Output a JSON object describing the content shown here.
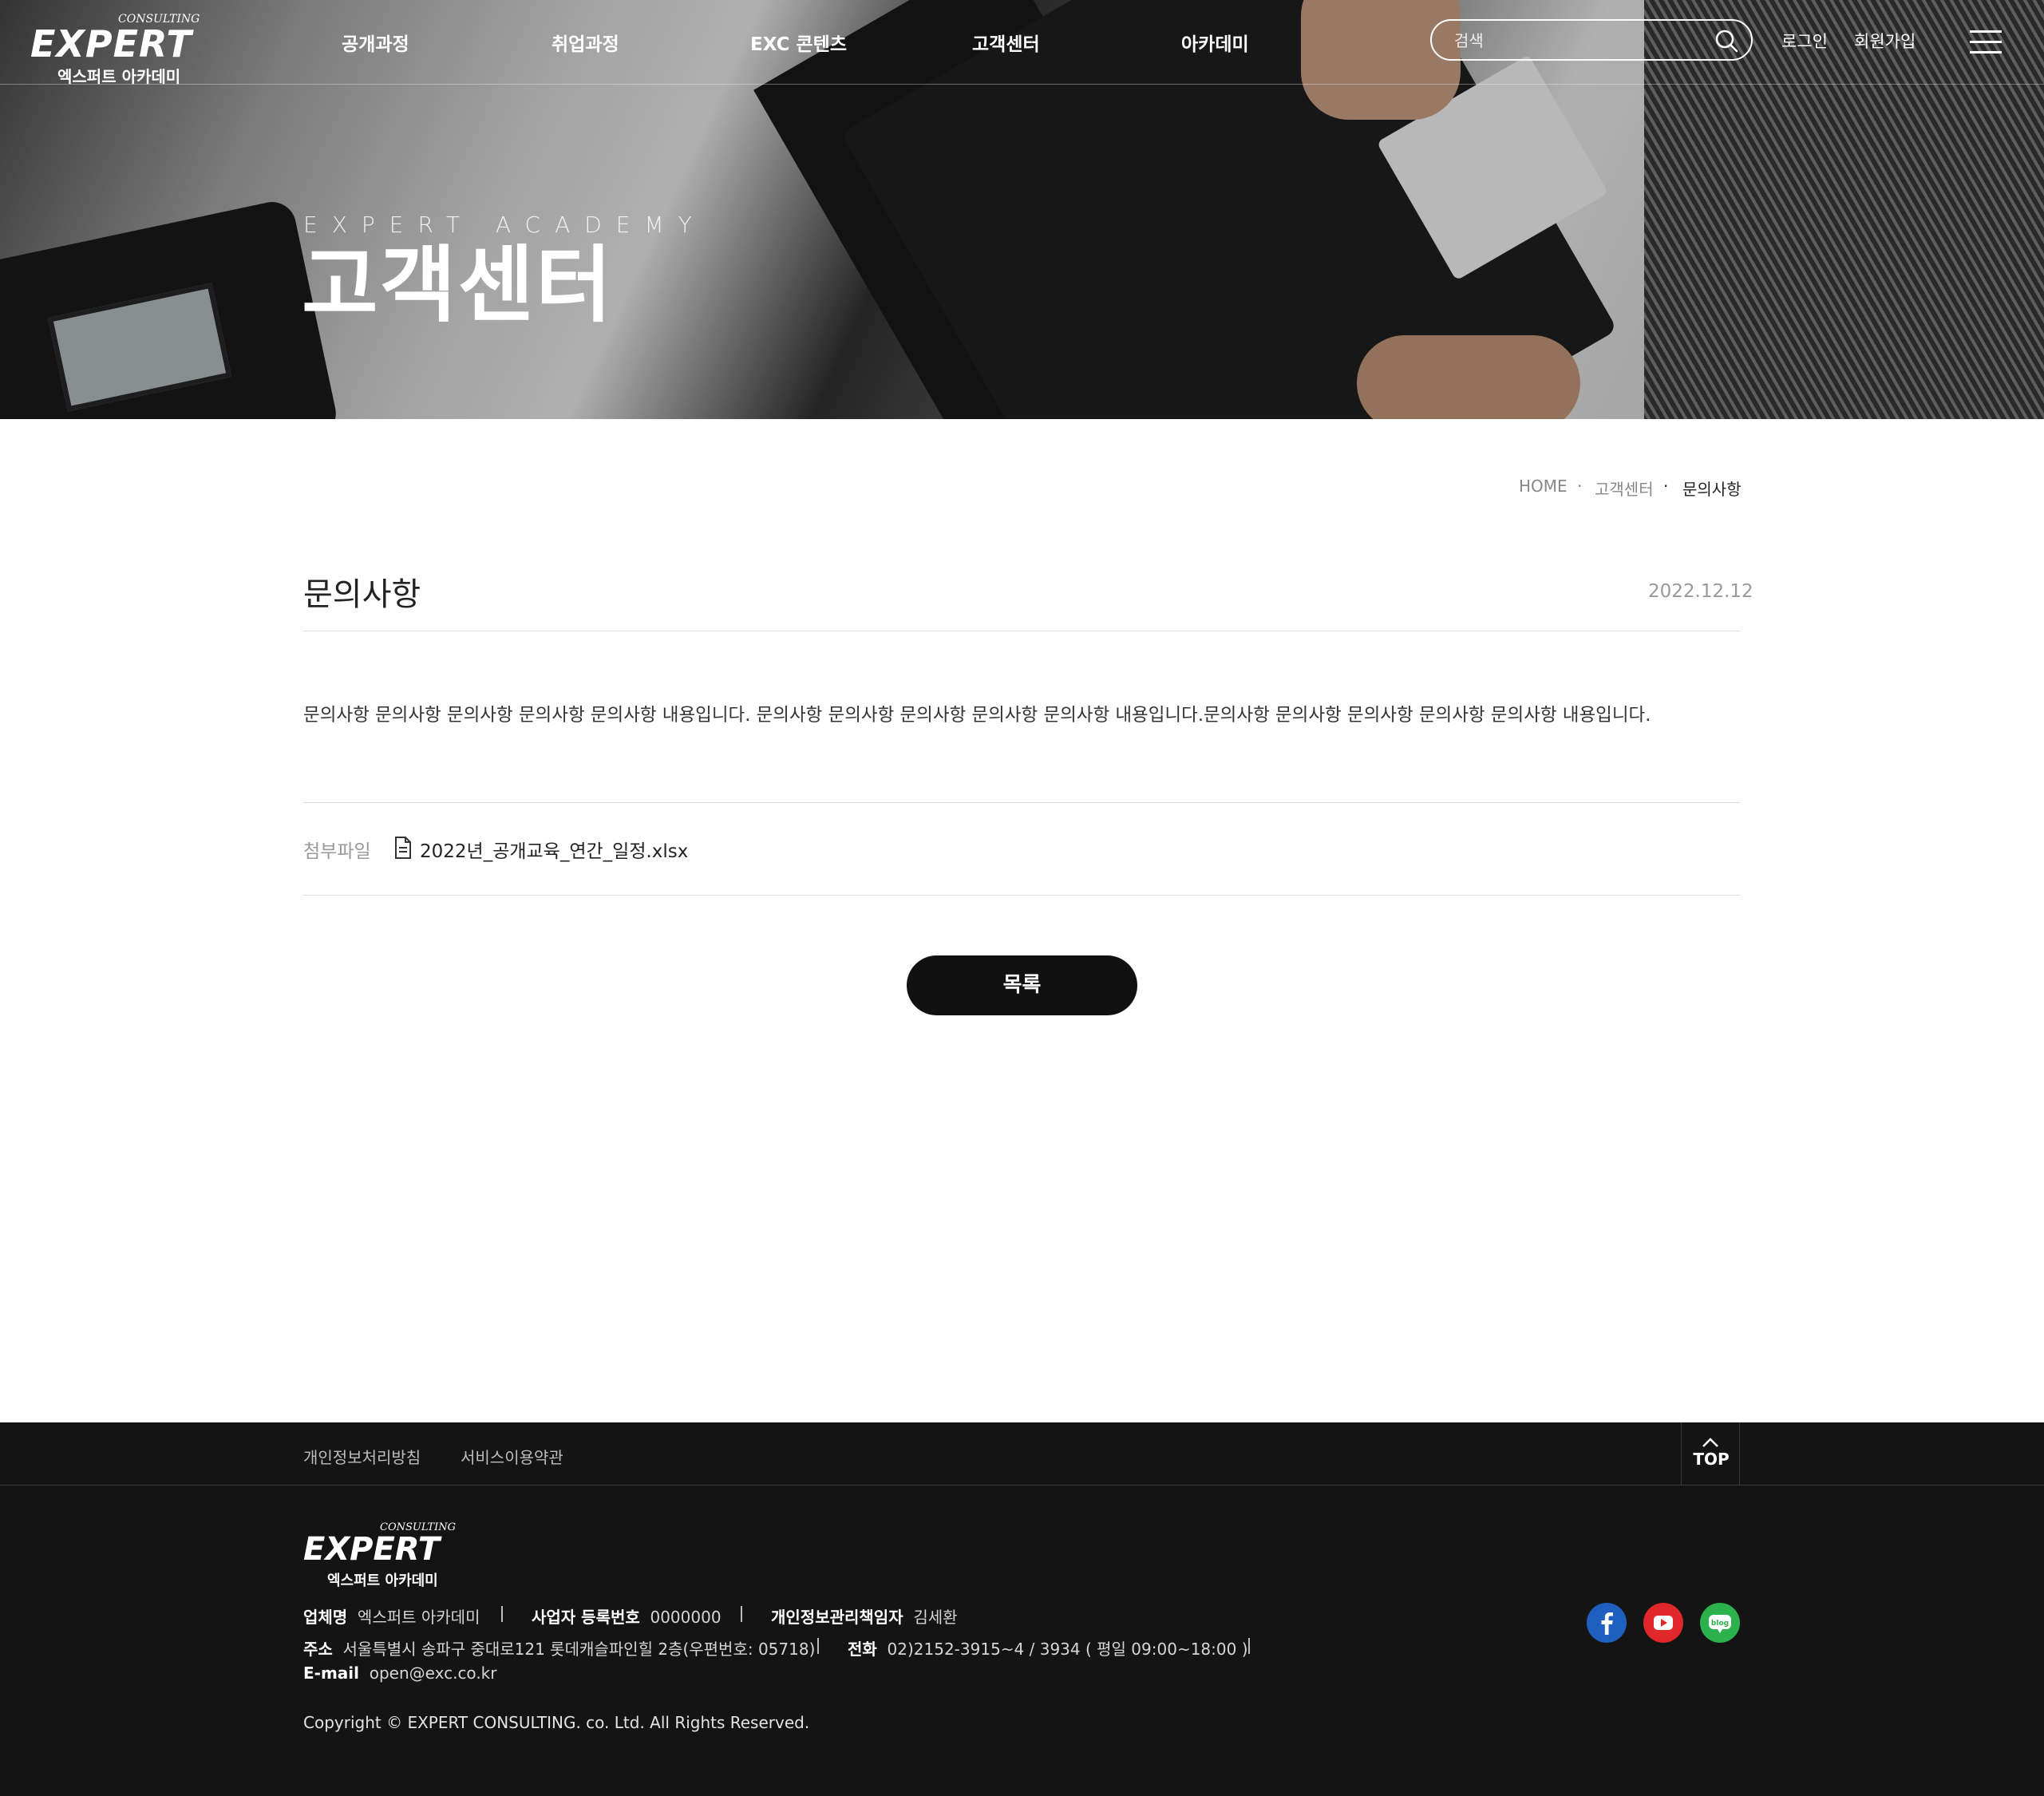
{
  "header": {
    "logo": {
      "wordmark": "EXPERT",
      "tag": "CONSULTING",
      "name_kr": "엑스퍼트 아카데미"
    },
    "nav": [
      "공개과정",
      "취업과정",
      "EXC 콘텐츠",
      "고객센터",
      "아카데미"
    ],
    "search": {
      "placeholder": "검색",
      "icon": "search-icon"
    },
    "util": {
      "login": "로그인",
      "signup": "회원가입"
    },
    "menu_icon": "hamburger-menu-icon"
  },
  "hero": {
    "subtitle": "EXPERT ACADEMY",
    "title": "고객센터"
  },
  "breadcrumb": [
    "HOME",
    "고객센터",
    "문의사항"
  ],
  "article": {
    "title": "문의사항",
    "date": "2022.12.12",
    "body": "문의사항 문의사항 문의사항 문의사항 문의사항 내용입니다. 문의사항 문의사항 문의사항 문의사항 문의사항 내용입니다.문의사항 문의사항 문의사항 문의사항 문의사항 내용입니다.",
    "attachment_label": "첨부파일",
    "attachment_file": "2022년_공개교육_연간_일정.xlsx",
    "list_button": "목록"
  },
  "footer": {
    "links": [
      "개인정보처리방침",
      "서비스이용약관"
    ],
    "top_button": "TOP",
    "logo": {
      "wordmark": "EXPERT",
      "tag": "CONSULTING",
      "name_kr": "엑스퍼트 아카데미"
    },
    "info": {
      "company_label": "업체명",
      "company": "엑스퍼트 아카데미",
      "bizno_label": "사업자 등록번호",
      "bizno": "0000000",
      "privacy_officer_label": "개인정보관리책임자",
      "privacy_officer": "김세환",
      "address_label": "주소",
      "address": "서울특별시 송파구 중대로121 롯데캐슬파인힐 2층(우편번호: 05718)",
      "phone_label": "전화",
      "phone": "02)2152-3915~4 / 3934 ( 평일 09:00~18:00 )",
      "email_label": "E-mail",
      "email": "open@exc.co.kr"
    },
    "copyright": "Copyright © EXPERT CONSULTING. co. Ltd. All Rights Reserved.",
    "social": [
      {
        "name": "facebook",
        "color": "#1f5fbf"
      },
      {
        "name": "youtube",
        "color": "#e0282b"
      },
      {
        "name": "blog",
        "color": "#2bb24c",
        "label": "blog"
      }
    ]
  }
}
